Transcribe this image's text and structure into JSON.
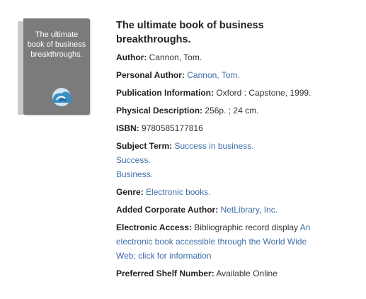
{
  "cover": {
    "title_lines": [
      "The ultimate",
      "book of business",
      "breakthroughs."
    ],
    "logo_icon": "cloud-logo-icon"
  },
  "record": {
    "title_line1": "The ultimate book of business",
    "title_line2": "breakthroughs.",
    "author": {
      "label": "Author:",
      "value": "Cannon, Tom."
    },
    "personal_author": {
      "label": "Personal Author:",
      "value": "Cannon, Tom."
    },
    "publication": {
      "label": "Publication Information:",
      "value": "Oxford : Capstone, 1999."
    },
    "physical": {
      "label": "Physical Description:",
      "value": "256p. ; 24 cm."
    },
    "isbn": {
      "label": "ISBN:",
      "value": "9780585177816"
    },
    "subject": {
      "label": "Subject Term:",
      "terms": [
        "Success in business.",
        "Success.",
        "Business."
      ]
    },
    "genre": {
      "label": "Genre:",
      "value": "Electronic books."
    },
    "corporate_author": {
      "label": "Added Corporate Author:",
      "value": "NetLibrary, Inc."
    },
    "electronic_access": {
      "label": "Electronic Access:",
      "text": "Bibliographic record display",
      "link_line1": "An",
      "link_line2": "electronic book accessible through the World Wide",
      "link_line3": "Web; click for information"
    },
    "shelf": {
      "label": "Preferred Shelf Number:",
      "value": "Available Online"
    }
  },
  "colors": {
    "link": "#3d6ea8",
    "cover": "#7b7b7b",
    "logo_blue": "#3a8fc0"
  }
}
